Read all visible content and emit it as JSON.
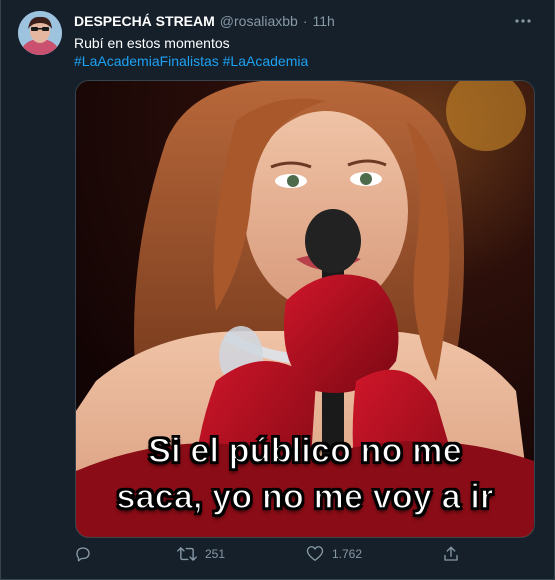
{
  "tweet": {
    "display_name": "DESPECHÁ STREAM",
    "handle": "@rosaliaxbb",
    "separator": "·",
    "time": "11h",
    "text": "Rubí en estos momentos",
    "hashtags": [
      "#LaAcademiaFinalistas",
      "#LaAcademia"
    ],
    "media": {
      "caption_line1": "Si el público no me",
      "caption_line2": "saca, yo no me voy a ir"
    },
    "actions": {
      "reply_count": "",
      "retweet_count": "251",
      "like_count": "1.762"
    },
    "icons": {
      "more": "more-icon",
      "reply": "reply-icon",
      "retweet": "retweet-icon",
      "like": "heart-icon",
      "share": "share-icon"
    },
    "colors": {
      "background": "#15202b",
      "accent": "#1da1f2",
      "muted": "#8899a6",
      "text": "#ffffff"
    }
  }
}
